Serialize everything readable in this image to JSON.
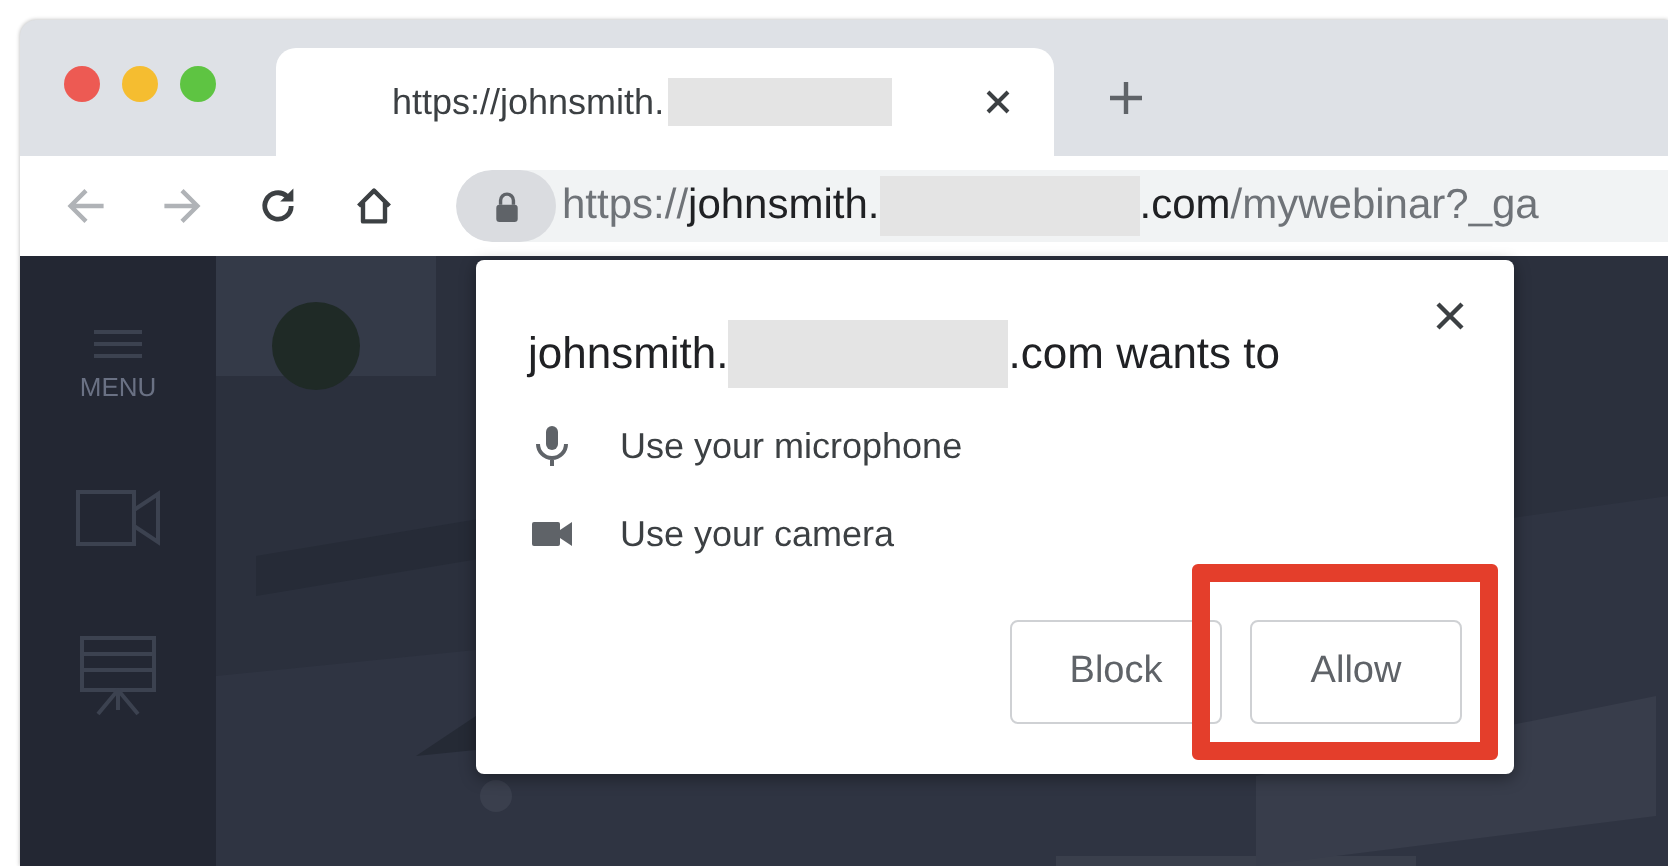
{
  "tab": {
    "title": "https://johnsmith.",
    "redacted": true,
    "selected": true
  },
  "toolbar": {
    "url": {
      "scheme": "https://",
      "host": "johnsmith.",
      "redacted": true,
      "host_end": ".com",
      "path": "/mywebinar?_ga"
    }
  },
  "sidebar": {
    "items": [
      {
        "kind": "menu",
        "label": "MENU"
      },
      {
        "kind": "video"
      },
      {
        "kind": "presentation"
      }
    ]
  },
  "dialog": {
    "title_start": "johnsmith.",
    "redacted": true,
    "title_end": ".com wants to",
    "permissions": [
      {
        "kind": "microphone",
        "label": "Use your microphone"
      },
      {
        "kind": "camera",
        "label": "Use your camera"
      }
    ],
    "buttons": [
      {
        "label": "Block",
        "highlighted": false
      },
      {
        "label": "Allow",
        "highlighted": true
      }
    ]
  }
}
